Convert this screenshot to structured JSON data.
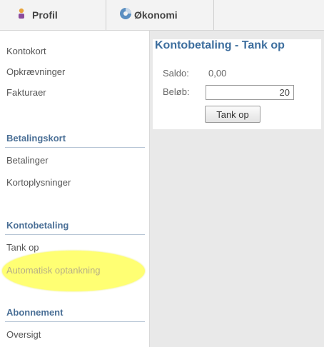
{
  "tabs": [
    {
      "label": "Profil",
      "icon": "person-icon"
    },
    {
      "label": "Økonomi",
      "icon": "pie-chart-icon"
    }
  ],
  "sidebar": {
    "group1": [
      "Kontokort",
      "Opkrævninger",
      "Fakturaer"
    ],
    "betalingskort": {
      "header": "Betalingskort",
      "items": [
        "Betalinger",
        "Kortoplysninger"
      ]
    },
    "kontobetaling": {
      "header": "Kontobetaling",
      "items": [
        "Tank op",
        "Automatisk optankning"
      ]
    },
    "abonnement": {
      "header": "Abonnement",
      "items": [
        "Oversigt"
      ]
    }
  },
  "main": {
    "title": "Kontobetaling - Tank op",
    "saldo_label": "Saldo:",
    "saldo_value": "0,00",
    "belob_label": "Beløb:",
    "belob_value": "20",
    "submit_label": "Tank op"
  },
  "colors": {
    "accent": "#3d6e9e",
    "highlight": "#ffff00"
  }
}
